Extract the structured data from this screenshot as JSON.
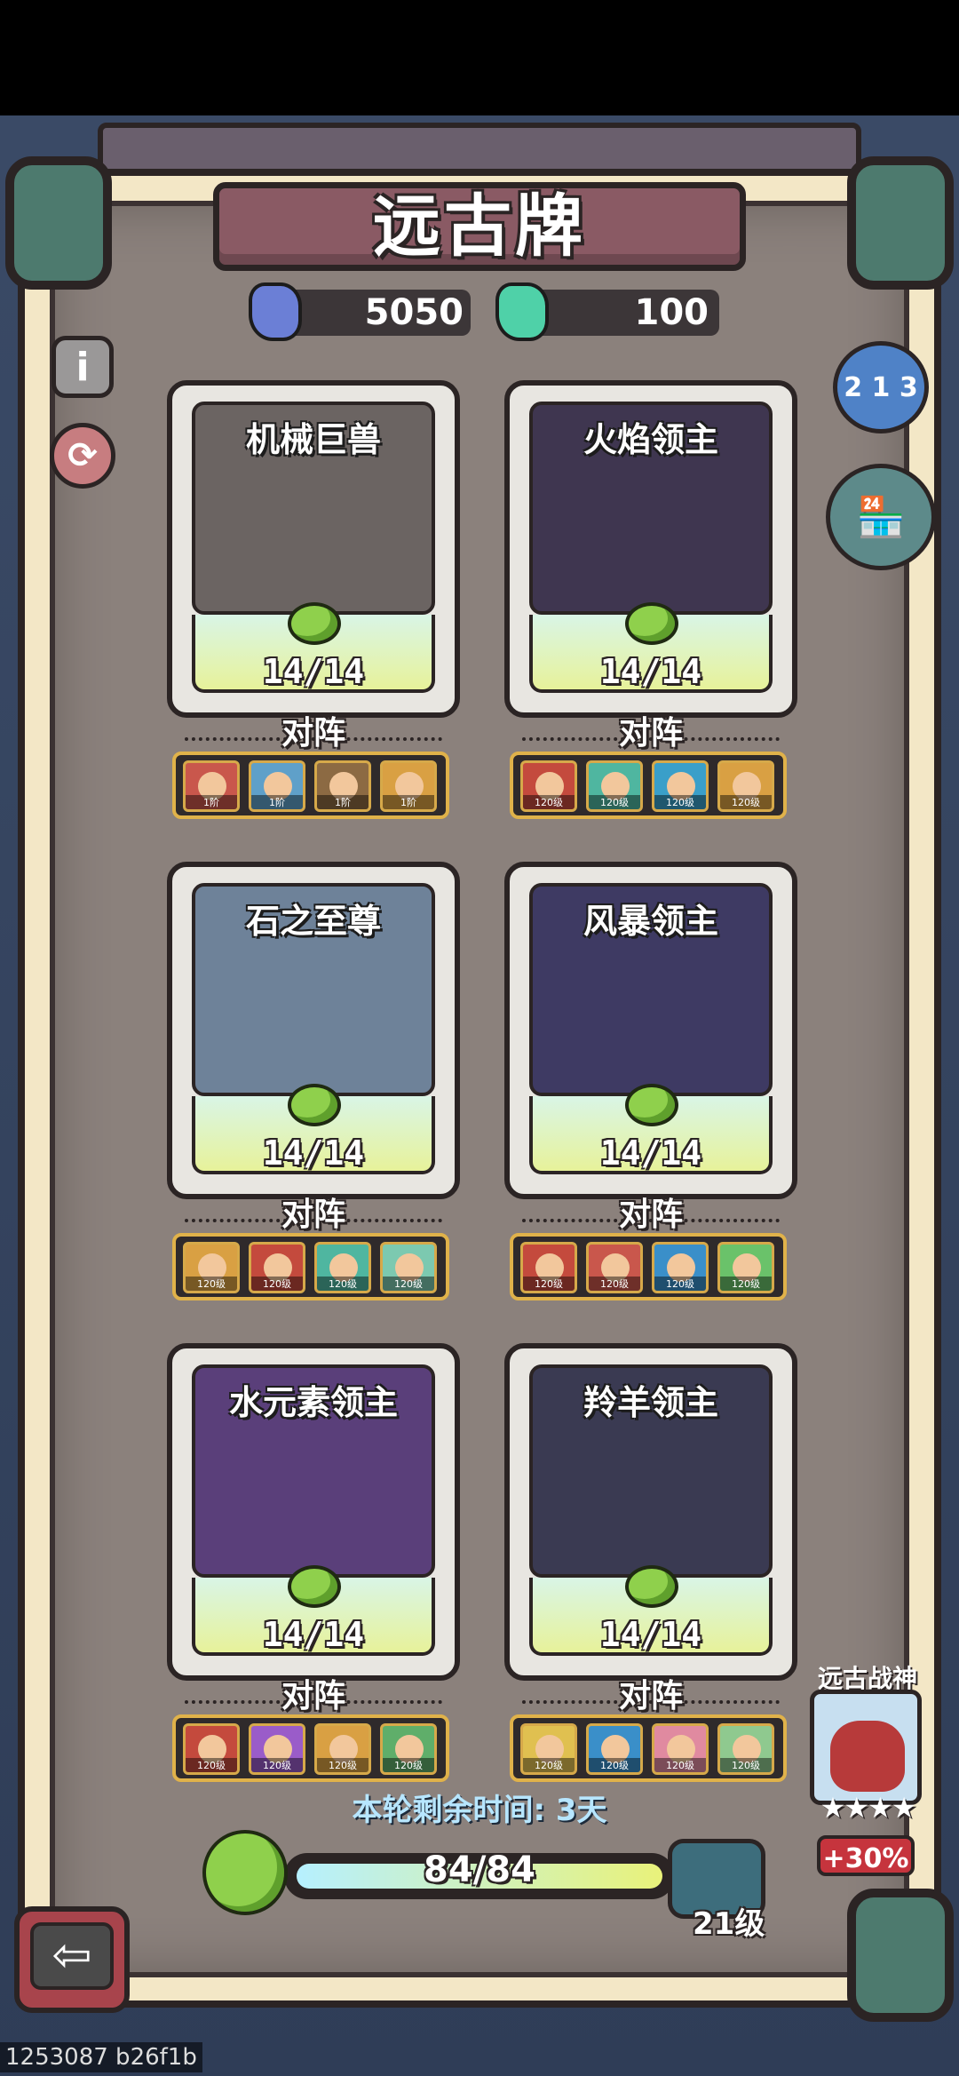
{
  "title": "远古牌",
  "currencies": [
    {
      "icon": "blue-gem-icon",
      "value": "5050",
      "color": "#6b7fd6"
    },
    {
      "icon": "green-gem-icon",
      "value": "100",
      "color": "#4fd1a8"
    }
  ],
  "side_buttons": {
    "info": "i",
    "ranking_icon": "podium-icon",
    "shop_icon": "shop-icon",
    "refresh_icon": "refresh-icon"
  },
  "cards": [
    {
      "name": "机械巨兽",
      "count": "14/14",
      "lineup_label": "对阵",
      "art_color": "#6b6462",
      "avatars": [
        {
          "level": "1阶",
          "color": "#c9574c"
        },
        {
          "level": "1阶",
          "color": "#5fa0c9"
        },
        {
          "level": "1阶",
          "color": "#8c6a43"
        },
        {
          "level": "1阶",
          "color": "#d9a043"
        }
      ]
    },
    {
      "name": "火焰领主",
      "count": "14/14",
      "lineup_label": "对阵",
      "art_color": "#3f3650",
      "avatars": [
        {
          "level": "120级",
          "color": "#c44a3d"
        },
        {
          "level": "120级",
          "color": "#4fb6a0"
        },
        {
          "level": "120级",
          "color": "#3a9fc9"
        },
        {
          "level": "120级",
          "color": "#d9a043"
        }
      ]
    },
    {
      "name": "石之至尊",
      "count": "14/14",
      "lineup_label": "对阵",
      "art_color": "#6e8299",
      "avatars": [
        {
          "level": "120级",
          "color": "#d9a043"
        },
        {
          "level": "120级",
          "color": "#c44a3d"
        },
        {
          "level": "120级",
          "color": "#4fb6a0"
        },
        {
          "level": "120级",
          "color": "#7cc9b0"
        }
      ]
    },
    {
      "name": "风暴领主",
      "count": "14/14",
      "lineup_label": "对阵",
      "art_color": "#3e3a63",
      "avatars": [
        {
          "level": "120级",
          "color": "#c44a3d"
        },
        {
          "level": "120级",
          "color": "#c9574c"
        },
        {
          "level": "120级",
          "color": "#3a8fc9"
        },
        {
          "level": "120级",
          "color": "#6ac26a"
        }
      ]
    },
    {
      "name": "水元素领主",
      "count": "14/14",
      "lineup_label": "对阵",
      "art_color": "#5a3f7a",
      "avatars": [
        {
          "level": "120级",
          "color": "#c44a3d"
        },
        {
          "level": "120级",
          "color": "#9a5cc9"
        },
        {
          "level": "120级",
          "color": "#d9a043"
        },
        {
          "level": "120级",
          "color": "#5fae6a"
        }
      ]
    },
    {
      "name": "羚羊领主",
      "count": "14/14",
      "lineup_label": "对阵",
      "art_color": "#3a3a52",
      "avatars": [
        {
          "level": "120级",
          "color": "#e0c050"
        },
        {
          "level": "120级",
          "color": "#3a8fc9"
        },
        {
          "level": "120级",
          "color": "#e08aa0"
        },
        {
          "level": "120级",
          "color": "#8fc98f"
        }
      ]
    }
  ],
  "timer": "本轮剩余时间: 3天",
  "progress": {
    "text": "84/84",
    "fraction": 1.0
  },
  "level": "21级",
  "ancient_god": {
    "label": "远古战神",
    "stars": "★★★★",
    "bonus": "+30%"
  },
  "back_icon": "back-arrow-icon",
  "watermark": "1253087 b26f1b"
}
